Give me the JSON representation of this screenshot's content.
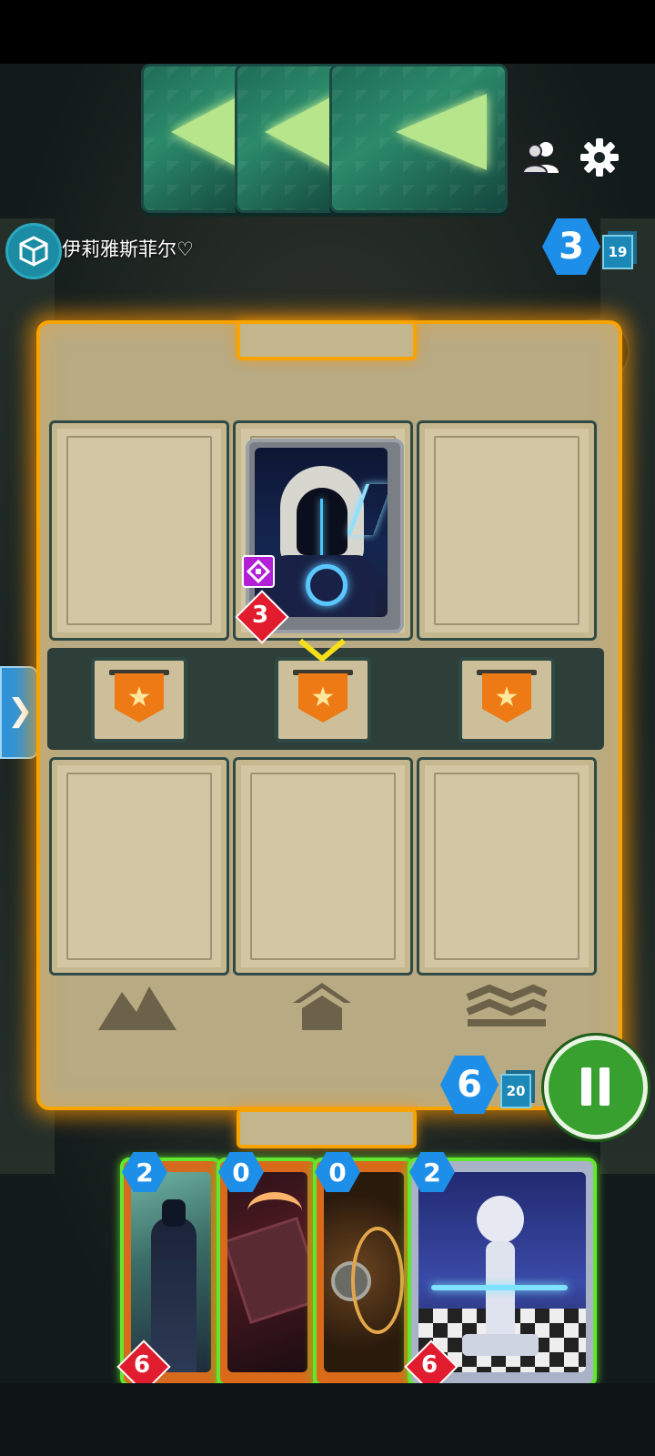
{
  "opponent": {
    "name": "伊莉雅斯菲尔♡",
    "energy": "3",
    "deck_count": "19",
    "played_card": {
      "power": "3"
    }
  },
  "player": {
    "energy": "6",
    "deck_count": "20",
    "hand": [
      {
        "cost": "2",
        "power": "6",
        "show_power": true
      },
      {
        "cost": "0",
        "power": "",
        "show_power": false
      },
      {
        "cost": "0",
        "power": "",
        "show_power": false
      },
      {
        "cost": "2",
        "power": "6",
        "show_power": true
      }
    ]
  },
  "icons": {
    "avatar": "cube-icon",
    "friends": "friends-icon",
    "settings": "gear-icon",
    "undo": "undo-icon",
    "side_panel": "chevron-right-icon",
    "end_turn": "pause-icon",
    "locations": [
      "mountain-icon",
      "house-icon",
      "waves-icon"
    ],
    "banner": "star-icon",
    "ability": "diamond-ability-icon"
  },
  "colors": {
    "board_glow": "#f7a300",
    "energy_blue": "#1d8fe8",
    "power_red": "#e11c2e",
    "end_turn_green": "#37a02e",
    "hand_border": "#62e62e"
  }
}
